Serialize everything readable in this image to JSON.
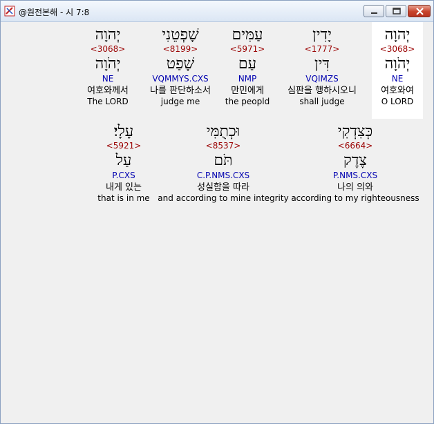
{
  "window": {
    "title": "@원전본해 - 시 7:8"
  },
  "rows": [
    [
      {
        "heb": "יְהוָה",
        "strong": "<3068>",
        "lemma": "יְהֹוָה",
        "morph": "NE",
        "kor": "여호와여",
        "eng": "O LORD",
        "selected": true
      },
      {
        "heb": "יָדִין",
        "strong": "<1777>",
        "lemma": "דִּין",
        "morph": "VQIMZS",
        "kor": "심판을 행하시오니",
        "eng": "shall judge",
        "selected": false
      },
      {
        "heb": "עַמִּים",
        "strong": "<5971>",
        "lemma": "עַם",
        "morph": "NMP",
        "kor": "만민에게",
        "eng": "the peopld",
        "selected": false
      },
      {
        "heb": "שָׁפְטֵנִי",
        "strong": "<8199>",
        "lemma": "שָׁפַט",
        "morph": "VQMMYS.CXS",
        "kor": "나를 판단하소서",
        "eng": "judge me",
        "selected": false
      },
      {
        "heb": "יְהוָה",
        "strong": "<3068>",
        "lemma": "יְהֹוָה",
        "morph": "NE",
        "kor": "여호와께서",
        "eng": "The LORD",
        "selected": false
      }
    ],
    [
      {
        "heb": "כְּצִדְקִי",
        "strong": "<6664>",
        "lemma": "צֶדֶק",
        "morph": "P.NMS.CXS",
        "kor": "나의 의와",
        "eng": "according to my righteousness",
        "selected": false
      },
      {
        "heb": "וּכְתֻמִּי",
        "strong": "<8537>",
        "lemma": "תֹּם",
        "morph": "C.P.NMS.CXS",
        "kor": "성실함을 따라",
        "eng": "and according to mine integrity",
        "selected": false
      },
      {
        "heb": "עָלָי׃",
        "strong": "<5921>",
        "lemma": "עַל",
        "morph": "P.CXS",
        "kor": "내게 있는",
        "eng": "that is in me",
        "selected": false
      }
    ]
  ]
}
